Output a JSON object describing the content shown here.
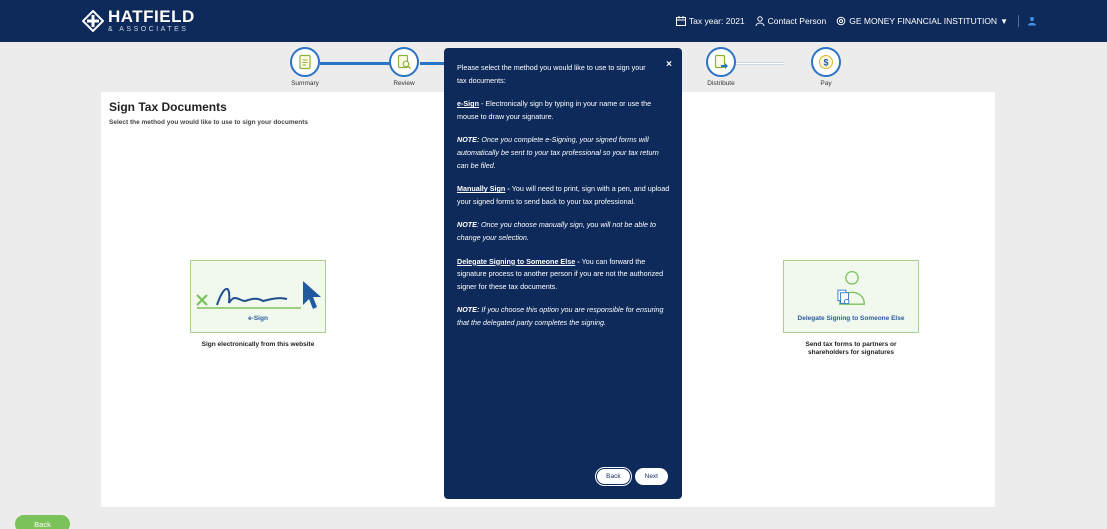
{
  "brand": {
    "name": "HATFIELD",
    "sub": "& ASSOCIATES"
  },
  "topbar": {
    "tax_year": "Tax year: 2021",
    "contact": "Contact Person",
    "institution": "GE MONEY FINANCIAL INSTITUTION"
  },
  "stepper": {
    "steps": [
      {
        "label": "Summary"
      },
      {
        "label": "Review"
      },
      {
        "label": ""
      },
      {
        "label": ""
      },
      {
        "label": "Distribute"
      },
      {
        "label": "Pay"
      }
    ]
  },
  "page": {
    "title": "Sign Tax Documents",
    "subtitle": "Select the method you would like to use to sign your documents"
  },
  "options": {
    "esign": {
      "label": "e-Sign",
      "caption": "Sign electronically from this website"
    },
    "delegate": {
      "label": "Delegate Signing to Someone Else",
      "caption_line1": "Send tax forms to partners or",
      "caption_line2": "shareholders for signatures"
    }
  },
  "modal": {
    "close": "×",
    "intro": "Please select the method you would like to use to sign your tax documents:",
    "esign_title": "e-Sign",
    "esign_text": " - Electronically sign by typing in your name or use the mouse to draw your signature.",
    "esign_note_label": "NOTE:",
    "esign_note_text": "  Once you complete e-Signing, your signed forms will automatically be sent to your tax professional so your tax return can be filed.",
    "manual_title": "Manually Sign",
    "manual_dash": " - ",
    "manual_text": " You will need to print, sign with a pen, and upload your signed forms to send back to your tax professional.",
    "manual_note_label": "NOTE",
    "manual_note_text": ": Once you choose manually sign, you will not be able to change your selection.",
    "delegate_title": "Delegate Signing to Someone Else",
    "delegate_dash": " - ",
    "delegate_text": " You can forward the signature process to another person if you are not the authorized signer for these tax documents.",
    "delegate_note_label": "NOTE:",
    "delegate_note_text": " If you choose this option you are responsible for ensuring that the delegated party completes the signing.",
    "back": "Back",
    "next": "Next"
  },
  "footer": {
    "back": "Back"
  },
  "colors": {
    "navy": "#0e2a5a",
    "blue": "#2a73c7",
    "green": "#7cc25a"
  }
}
